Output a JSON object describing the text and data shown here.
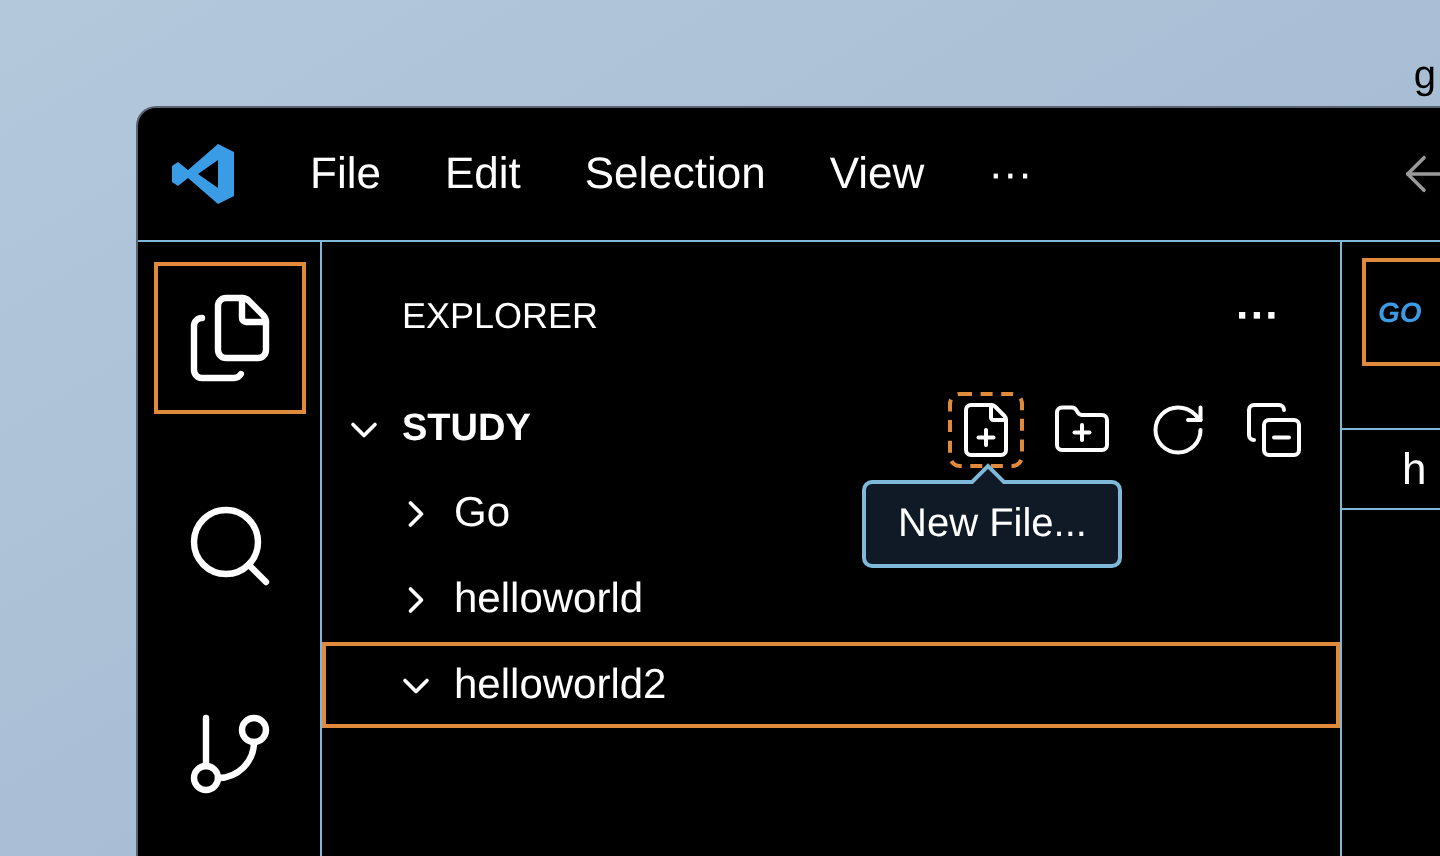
{
  "desktop_text": "g",
  "menu": [
    "File",
    "Edit",
    "Selection",
    "View",
    "···"
  ],
  "activity_bar": [
    {
      "kind": "explorer",
      "selected": true
    },
    {
      "kind": "search",
      "selected": false
    },
    {
      "kind": "source-control",
      "selected": false
    }
  ],
  "explorer": {
    "title": "EXPLORER",
    "more": "···",
    "folder": {
      "name": "STUDY",
      "expanded": true
    },
    "actions": [
      {
        "kind": "new-file",
        "focused": true
      },
      {
        "kind": "new-folder",
        "focused": false
      },
      {
        "kind": "refresh",
        "focused": false
      },
      {
        "kind": "collapse",
        "focused": false
      }
    ],
    "items": [
      {
        "name": "Go",
        "expanded": false,
        "selected": false
      },
      {
        "name": "helloworld",
        "expanded": false,
        "selected": false
      },
      {
        "name": "helloworld2",
        "expanded": true,
        "selected": true
      }
    ]
  },
  "tooltip": "New File...",
  "editor": {
    "tab_logo": "GO",
    "tab_text": "h"
  }
}
